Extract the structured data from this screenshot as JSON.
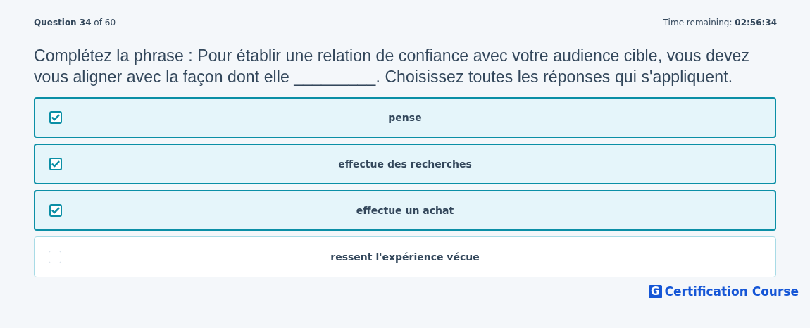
{
  "header": {
    "progress": "**Question 34** of 60",
    "timer": "Time remaining: **02:56:34**"
  },
  "question": "Complétez la phrase : Pour établir une relation de confiance avec votre audience cible, vous devez vous aligner avec la façon dont elle _________. Choisissez toutes les réponses qui s'appliquent.",
  "options": [
    {
      "label": "pense",
      "checked": true
    },
    {
      "label": "effectue des recherches",
      "checked": true
    },
    {
      "label": "effectue un achat",
      "checked": true
    },
    {
      "label": "ressent l'expérience vécue",
      "checked": false
    }
  ],
  "brand": {
    "mark": "G",
    "name": "Certification Course"
  }
}
